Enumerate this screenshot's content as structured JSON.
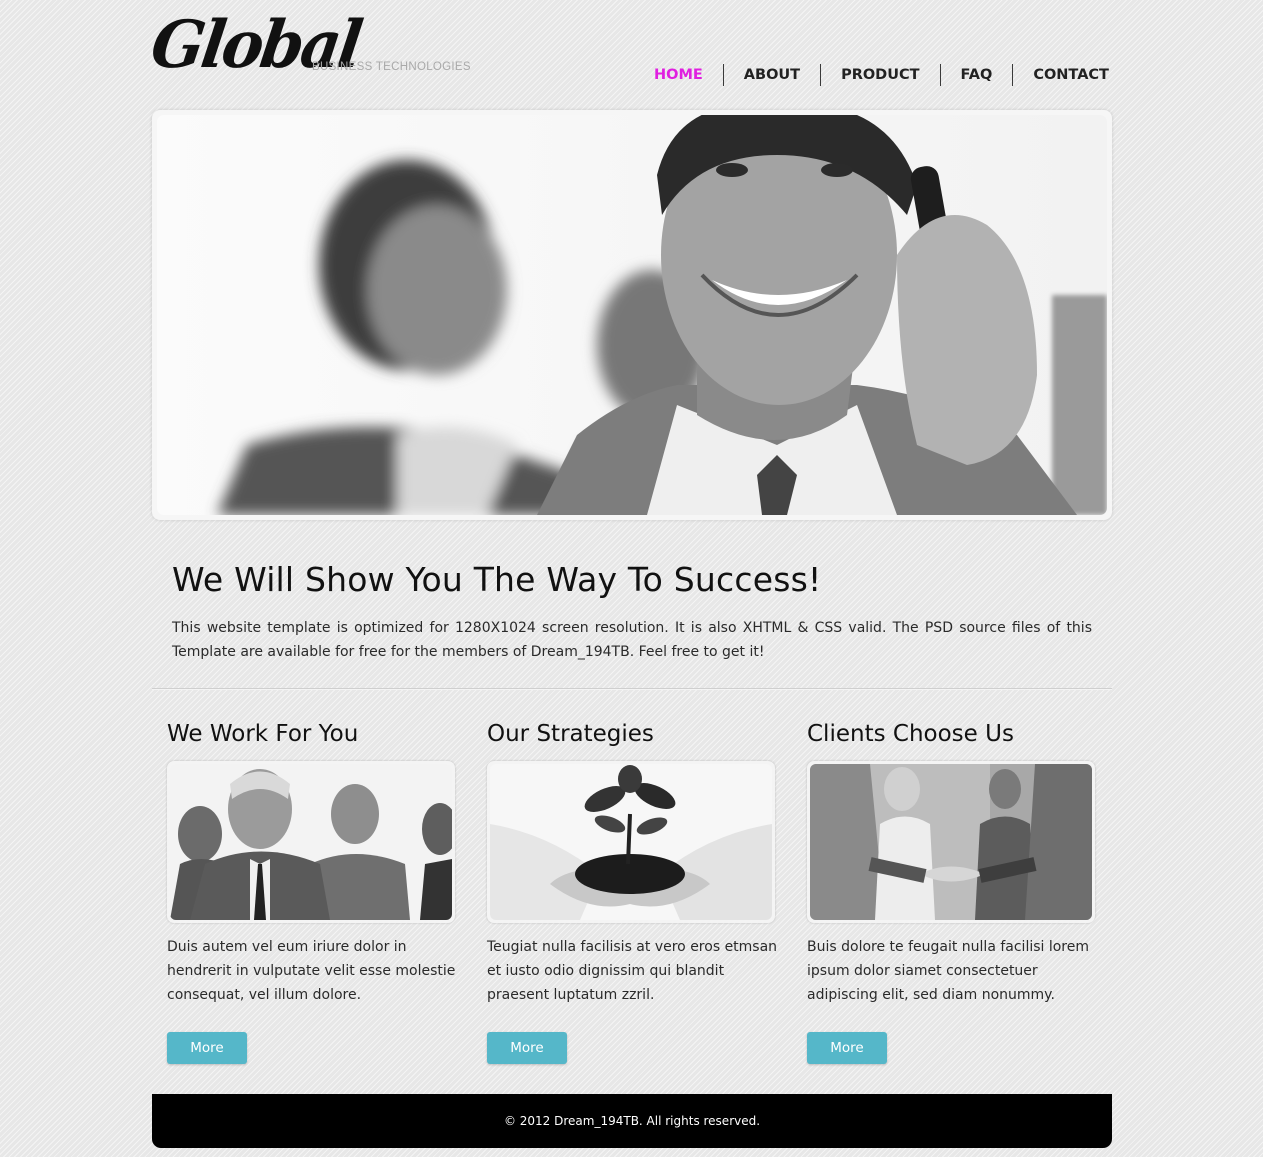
{
  "header": {
    "logo_text": "Global",
    "tagline": "BUSINESS TECHNOLOGIES",
    "nav": [
      {
        "label": "HOME",
        "active": true
      },
      {
        "label": "ABOUT",
        "active": false
      },
      {
        "label": "PRODUCT",
        "active": false
      },
      {
        "label": "FAQ",
        "active": false
      },
      {
        "label": "CONTACT",
        "active": false
      }
    ],
    "active_color": "#e01fe0"
  },
  "intro": {
    "title": "We Will Show You The Way To Success!",
    "text": "This website template is optimized for 1280X1024 screen resolution. It is also XHTML & CSS valid. The PSD source files of this Template are available for free for the members of Dream_194TB. Feel free to get it!"
  },
  "columns": [
    {
      "title": "We Work For You",
      "image_icon": "business-team-photo",
      "text": "Duis autem vel eum iriure dolor in hendrerit in vulputate velit esse molestie consequat, vel illum dolore.",
      "button": "More"
    },
    {
      "title": "Our Strategies",
      "image_icon": "plant-in-hands-photo",
      "text": "Teugiat nulla facilisis at vero eros etmsan et iusto odio dignissim qui blandit praesent luptatum zzril.",
      "button": "More"
    },
    {
      "title": "Clients Choose Us",
      "image_icon": "handshake-photo",
      "text": "Buis dolore te feugait nulla facilisi lorem ipsum dolor siamet consectetuer adipiscing elit, sed diam nonummy.",
      "button": "More"
    }
  ],
  "footer": {
    "copyright": "© 2012 Dream_194TB. All rights reserved."
  },
  "colors": {
    "button": "#55b7c9",
    "footer": "#000000"
  }
}
